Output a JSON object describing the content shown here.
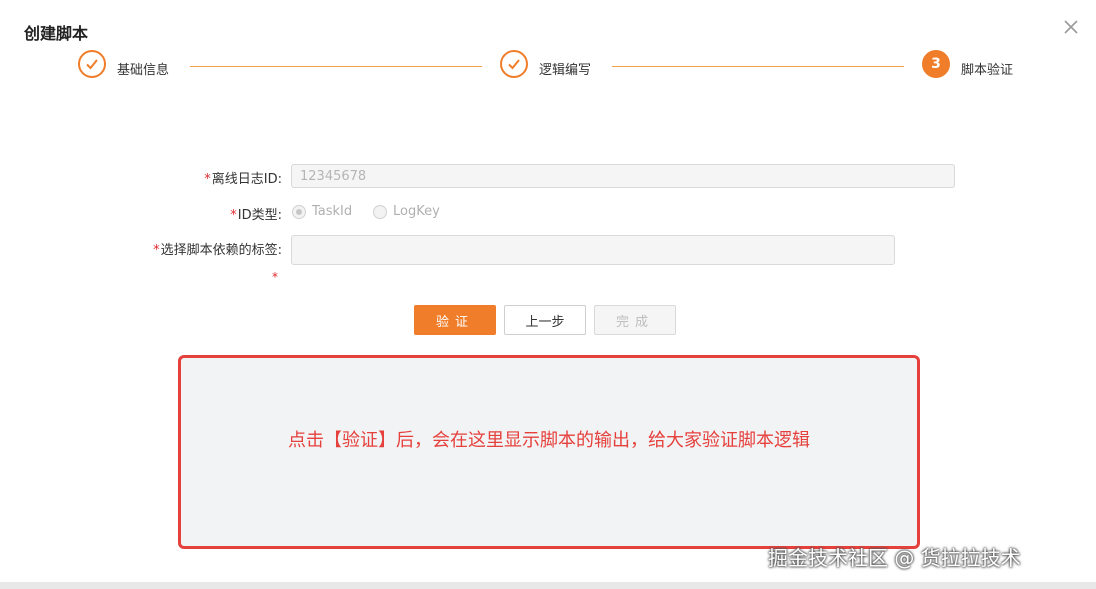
{
  "modal": {
    "title": "创建脚本"
  },
  "steps": [
    {
      "label": "基础信息",
      "status": "done"
    },
    {
      "label": "逻辑编写",
      "status": "done"
    },
    {
      "label": "脚本验证",
      "status": "active",
      "number": "3"
    }
  ],
  "form": {
    "log_id": {
      "required": "*",
      "label": "离线日志ID:",
      "placeholder": "12345678"
    },
    "id_type": {
      "required": "*",
      "label": "ID类型:",
      "options": [
        {
          "label": "TaskId",
          "checked": true
        },
        {
          "label": "LogKey",
          "checked": false
        }
      ]
    },
    "tags": {
      "required": "*",
      "label": "选择脚本依赖的标签:",
      "value": ""
    },
    "extra_required": "*"
  },
  "buttons": {
    "verify": "验证",
    "prev": "上一步",
    "finish": "完成"
  },
  "output": {
    "hint": "点击【验证】后，会在这里显示脚本的输出，给大家验证脚本逻辑"
  },
  "watermark": "掘金技术社区 @ 货拉拉技术",
  "colors": {
    "accent": "#f07d2a",
    "highlight": "#e6403c"
  }
}
